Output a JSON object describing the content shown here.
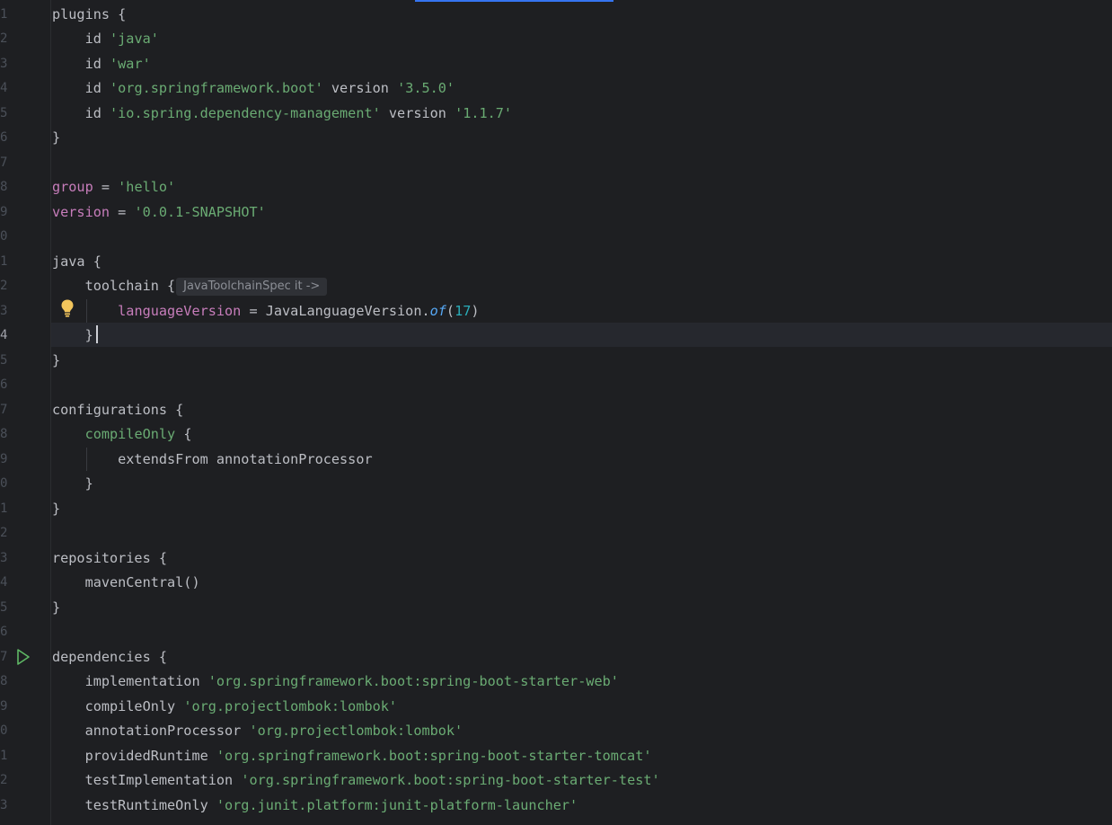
{
  "editor": {
    "hint": "JavaToolchainSpec it ->",
    "line_numbers": [
      "1",
      "2",
      "3",
      "4",
      "5",
      "6",
      "7",
      "8",
      "9",
      "0",
      "1",
      "2",
      "3",
      "4",
      "5",
      "6",
      "7",
      "8",
      "9",
      "0",
      "1",
      "2",
      "3",
      "4",
      "5",
      "6",
      "7",
      "8",
      "9",
      "0",
      "1",
      "2",
      "3"
    ],
    "lines": {
      "l1": [
        "plugins {"
      ],
      "l2": [
        "    id ",
        "'java'"
      ],
      "l3": [
        "    id ",
        "'war'"
      ],
      "l4": [
        "    id ",
        "'org.springframework.boot'",
        " version ",
        "'3.5.0'"
      ],
      "l5": [
        "    id ",
        "'io.spring.dependency-management'",
        " version ",
        "'1.1.7'"
      ],
      "l6": [
        "}"
      ],
      "l8": [
        "group",
        " = ",
        "'hello'"
      ],
      "l9": [
        "version",
        " = ",
        "'0.0.1-SNAPSHOT'"
      ],
      "l11": [
        "java {"
      ],
      "l12": [
        "    toolchain {"
      ],
      "l13": [
        "        ",
        "languageVersion",
        " = JavaLanguageVersion.",
        "of",
        "(",
        "17",
        ")"
      ],
      "l14": [
        "    }"
      ],
      "l15": [
        "}"
      ],
      "l17": [
        "configurations {"
      ],
      "l18": [
        "    ",
        "compileOnly",
        " {"
      ],
      "l19": [
        "        extendsFrom annotationProcessor"
      ],
      "l20": [
        "    }"
      ],
      "l21": [
        "}"
      ],
      "l23": [
        "repositories {"
      ],
      "l24": [
        "    mavenCentral()"
      ],
      "l25": [
        "}"
      ],
      "l27": [
        "dependencies {"
      ],
      "l28": [
        "    implementation ",
        "'org.springframework.boot:spring-boot-starter-web'"
      ],
      "l29": [
        "    compileOnly ",
        "'org.projectlombok:lombok'"
      ],
      "l30": [
        "    annotationProcessor ",
        "'org.projectlombok:lombok'"
      ],
      "l31": [
        "    providedRuntime ",
        "'org.springframework.boot:spring-boot-starter-tomcat'"
      ],
      "l32": [
        "    testImplementation ",
        "'org.springframework.boot:spring-boot-starter-test'"
      ],
      "l33": [
        "    testRuntimeOnly ",
        "'org.junit.platform:junit-platform-launcher'"
      ]
    },
    "icons": {
      "bulb": "lightbulb-icon",
      "run": "run-gutter-icon"
    },
    "colors": {
      "background": "#1e1f22",
      "string": "#6aab73",
      "keyword_property": "#c77dbb",
      "number": "#2aacb8",
      "method_italic": "#56a8f5",
      "accent": "#3574f0"
    }
  }
}
